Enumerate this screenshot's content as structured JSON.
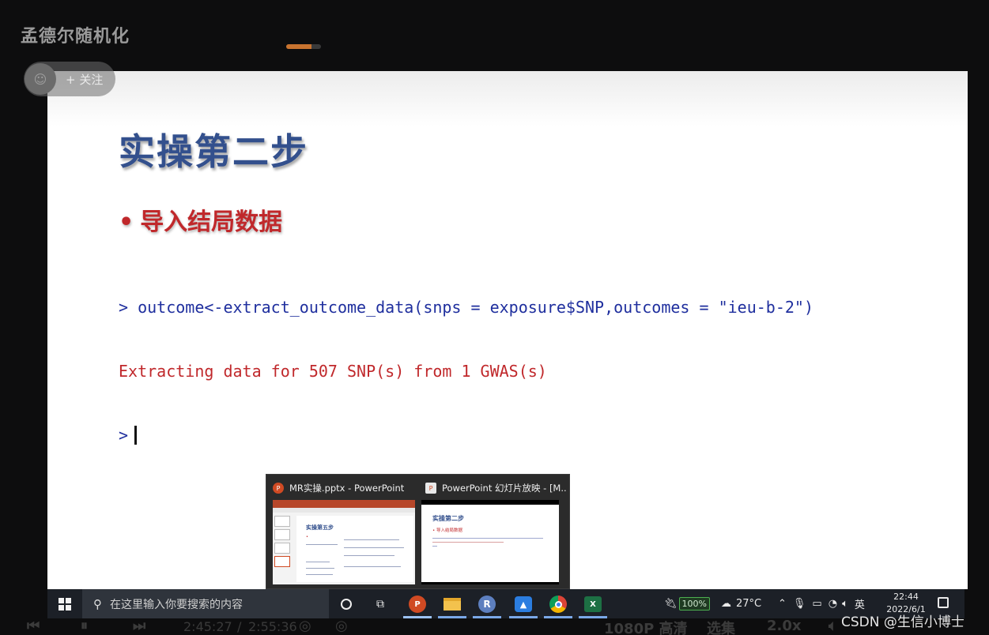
{
  "player": {
    "channel_name": "孟德尔随机化",
    "follow_label": "+ 关注",
    "progress_fraction": 0.72,
    "time_current": "2:45:27",
    "time_separator": "/",
    "time_total": "2:55:36",
    "quality": "1080P 高清",
    "episodes": "选集",
    "speed": "2.0x"
  },
  "slide": {
    "title": "实操第二步",
    "bullet_mark": "•",
    "bullet": "导入结局数据",
    "console": {
      "command": "> outcome<-extract_outcome_data(snps = exposure$SNP,outcomes = \"ieu-b-2\")",
      "message": "Extracting data for 507 SNP(s) from 1 GWAS(s)",
      "prompt": ">"
    },
    "colors": {
      "title": "#33508d",
      "bullet": "#c0282b",
      "console_command": "#1f2f9e",
      "console_message": "#c0282b"
    }
  },
  "taskbar_popup": {
    "items": [
      {
        "title": "MR实操.pptx - PowerPoint",
        "icon": "powerpoint-icon",
        "preview_title": "实操第五步"
      },
      {
        "title": "PowerPoint 幻灯片放映 - [M...",
        "icon": "powerpoint-slideshow-icon",
        "preview_title": "实操第二步",
        "preview_bullet": "• 导入结局数据"
      }
    ]
  },
  "taskbar": {
    "search_placeholder": "在这里输入你要搜索的内容",
    "apps": [
      "cortana-icon",
      "task-view-icon",
      "powerpoint-icon",
      "file-explorer-icon",
      "r-icon",
      "meeting-app-icon",
      "chrome-icon",
      "excel-icon"
    ],
    "battery": "100%",
    "weather": "27°C",
    "ime": "英",
    "time": "22:44",
    "date": "2022/6/1"
  },
  "watermark": "CSDN @生信小博士"
}
